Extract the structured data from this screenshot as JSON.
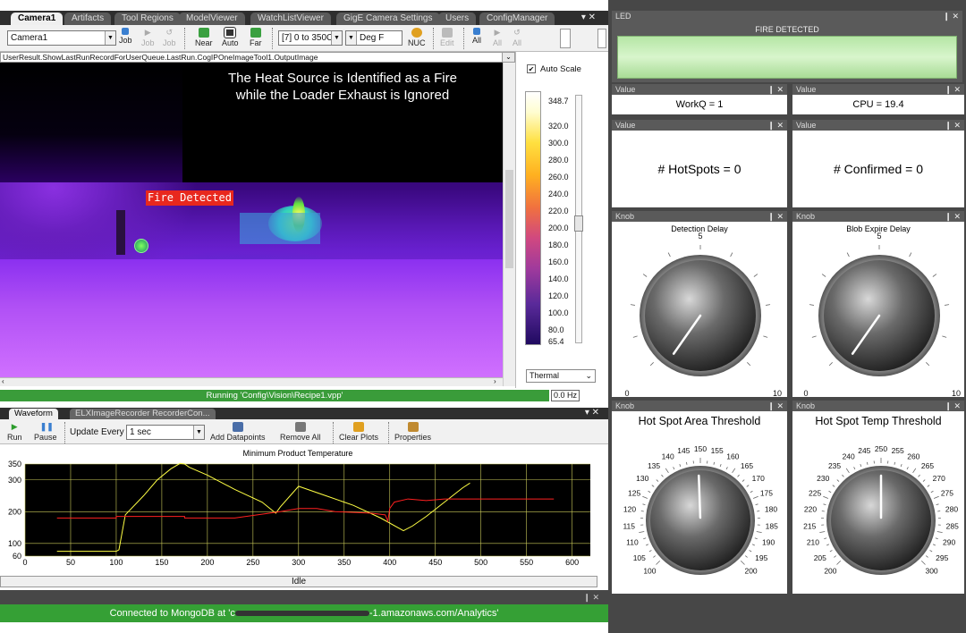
{
  "tabs": [
    "Camera1",
    "Artifacts",
    "Tool Regions",
    "ModelViewer",
    "WatchListViewer",
    "GigE Camera Settings",
    "Users",
    "ConfigManager"
  ],
  "tab_controls": "▾ ✕",
  "toolbar": {
    "camera_select": "Camera1",
    "job_label": "Job",
    "job2_label": "Job",
    "job3_label": "Job",
    "near_label": "Near",
    "auto_label": "Auto",
    "far_label": "Far",
    "range_select": "[7] 0 to 350C",
    "unit_select": "Deg F",
    "nuc_label": "NUC",
    "edit_label": "Edit",
    "all_label": "All",
    "all2_label": "All",
    "all3_label": "All"
  },
  "path_text": "UserResult.ShowLastRunRecordForUserQueue.LastRun.CogIPOneImageTool1.OutputImage",
  "image_caption_line1": "The Heat Source is Identified as a Fire",
  "image_caption_line2": "while the Loader Exhaust is Ignored",
  "fire_label": "Fire Detected",
  "colorbar": {
    "auto_scale_label": "Auto Scale",
    "ticks": [
      "348.7",
      "320.0",
      "300.0",
      "280.0",
      "260.0",
      "240.0",
      "220.0",
      "200.0",
      "180.0",
      "160.0",
      "140.0",
      "120.0",
      "100.0",
      "80.0",
      "65.4"
    ],
    "palette": "Thermal"
  },
  "running_status": "Running 'Config\\Vision\\Recipe1.vpp'",
  "hz_text": "0.0 Hz",
  "bottom_tabs": [
    "Waveform",
    "ELXImageRecorder RecorderCon..."
  ],
  "toolbar2": {
    "run_label": "Run",
    "pause_label": "Pause",
    "update_every_label": "Update Every",
    "update_value": "1 sec",
    "add_datapoints_label": "Add Datapoints",
    "remove_all_label": "Remove All",
    "clear_plots_label": "Clear Plots",
    "properties_label": "Properties"
  },
  "chart_data": {
    "type": "line",
    "title": "Minimum Product Temperature",
    "xlabel": "",
    "ylabel": "",
    "xlim": [
      0,
      620
    ],
    "ylim": [
      60,
      350
    ],
    "xticks": [
      0,
      50,
      100,
      150,
      200,
      250,
      300,
      350,
      400,
      450,
      500,
      550,
      600
    ],
    "yticks": [
      60,
      100,
      200,
      300,
      350
    ],
    "grid": true,
    "series": [
      {
        "color": "#ffff44",
        "x": [
          35,
          100,
          103,
          110,
          130,
          145,
          160,
          170,
          175,
          180,
          200,
          230,
          260,
          275,
          280,
          300,
          330,
          360,
          390,
          415,
          425,
          440,
          460,
          480,
          488
        ],
        "y": [
          75,
          75,
          80,
          190,
          250,
          300,
          335,
          352,
          350,
          340,
          315,
          270,
          230,
          195,
          215,
          280,
          250,
          220,
          180,
          140,
          155,
          185,
          230,
          275,
          290
        ]
      },
      {
        "color": "#ff2020",
        "x": [
          35,
          100,
          100,
          175,
          175,
          180,
          230,
          280,
          300,
          320,
          330,
          340,
          380,
          395,
          398,
          400,
          405,
          420,
          440,
          460,
          520,
          550,
          580
        ],
        "y": [
          180,
          180,
          185,
          185,
          180,
          180,
          180,
          200,
          210,
          210,
          205,
          200,
          195,
          190,
          170,
          210,
          230,
          240,
          235,
          240,
          240,
          240,
          240
        ]
      }
    ]
  },
  "idle_text": "Idle",
  "mongo_controls": "❙ ✕",
  "mongo_prefix": "Connected to MongoDB at 'c",
  "mongo_suffix": "-1.amazonaws.com/Analytics'",
  "right_panels": {
    "led_header": "LED",
    "led_text": "FIRE DETECTED",
    "value_header": "Value",
    "workq": "WorkQ = 1",
    "cpu": "CPU = 19.4",
    "hotspots": "# HotSpots = 0",
    "confirmed": "# Confirmed = 0",
    "knob_header": "Knob",
    "knob1_title": "Detection Delay",
    "knob2_title": "Blob Expire Delay",
    "knob3_title": "Hot Spot Area Threshold",
    "knob4_title": "Hot Spot Temp Threshold",
    "panel_controls": "❙ ✕",
    "knob_small_labels": [
      "0",
      "5",
      "10"
    ],
    "knob3_labels": [
      "100",
      "105",
      "110",
      "115",
      "120",
      "125",
      "130",
      "135",
      "140",
      "145",
      "150",
      "155",
      "160",
      "165",
      "170",
      "175",
      "180",
      "185",
      "190",
      "195",
      "200"
    ],
    "knob4_labels": [
      "200",
      "205",
      "210",
      "215",
      "220",
      "225",
      "230",
      "235",
      "240",
      "245",
      "250",
      "255",
      "260",
      "265",
      "270",
      "275",
      "280",
      "285",
      "290",
      "295",
      "300"
    ]
  },
  "colors": {
    "accent_green": "#35a035",
    "fire_red": "#e8281e",
    "led_green": "#c8f0b8"
  }
}
